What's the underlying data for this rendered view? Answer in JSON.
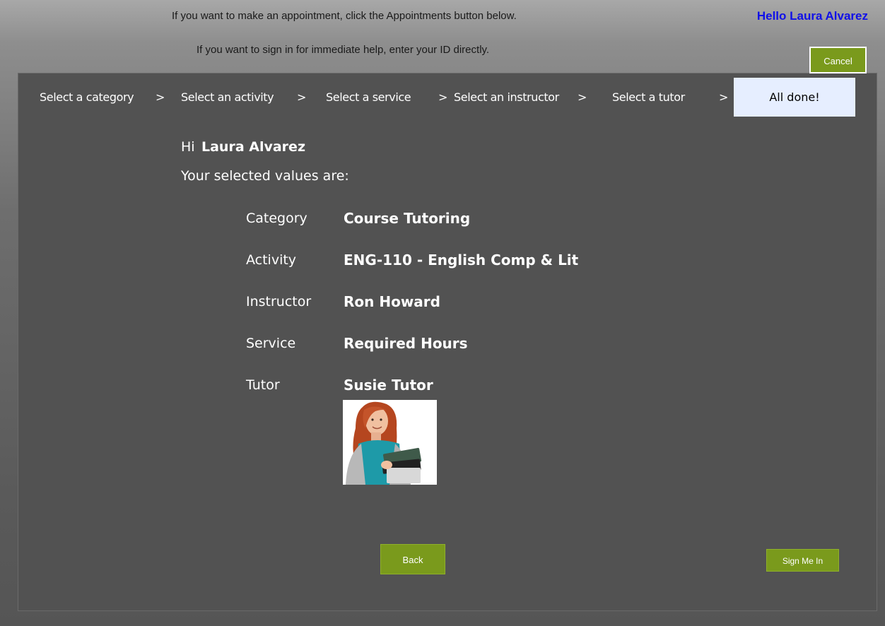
{
  "header": {
    "appointment_text": "If you want to make an appointment, click the Appointments button below.",
    "signin_text": "If you want to sign in for immediate help, enter your ID directly.",
    "greeting": "Hello Laura Alvarez",
    "cancel_label": "Cancel"
  },
  "steps": [
    {
      "label": "Select a category"
    },
    {
      "label": "Select an activity"
    },
    {
      "label": "Select a service"
    },
    {
      "label": "Select an instructor"
    },
    {
      "label": "Select a tutor"
    },
    {
      "label": "All done!"
    }
  ],
  "separator": ">",
  "summary": {
    "hi": "Hi",
    "name": "Laura Alvarez",
    "intro": "Your selected values are:",
    "rows": [
      {
        "label": "Category",
        "value": "Course Tutoring"
      },
      {
        "label": "Activity",
        "value": "ENG-110 - English Comp & Lit"
      },
      {
        "label": "Instructor",
        "value": "Ron Howard"
      },
      {
        "label": "Service",
        "value": "Required Hours"
      },
      {
        "label": "Tutor",
        "value": "Susie Tutor"
      }
    ]
  },
  "actions": {
    "back_label": "Back",
    "signin_label": "Sign Me In"
  },
  "colors": {
    "accent_button": "#7a9a1c",
    "greeting_blue": "#1010e8",
    "panel": "#525252",
    "active_step": "#e6eeff"
  }
}
